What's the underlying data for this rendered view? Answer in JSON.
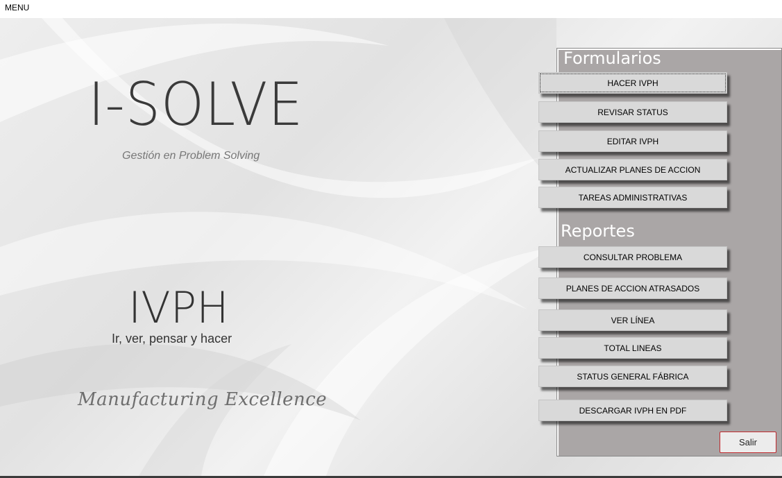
{
  "window": {
    "title": "MENU"
  },
  "branding": {
    "name": "I-SOLVE",
    "tagline": "Gestión en Problem Solving",
    "program": "IVPH",
    "program_tagline": "Ir, ver, pensar y hacer",
    "slogan": "Manufacturing Excellence"
  },
  "formularios": {
    "title": "Formularios",
    "buttons": [
      "HACER IVPH",
      "REVISAR STATUS",
      "EDITAR IVPH",
      "ACTUALIZAR PLANES DE ACCION",
      "TAREAS ADMINISTRATIVAS"
    ]
  },
  "reportes": {
    "title": "Reportes",
    "buttons": [
      "CONSULTAR PROBLEMA",
      "PLANES DE ACCION ATRASADOS",
      "VER LÍNEA",
      "TOTAL LINEAS",
      "STATUS GENERAL FÁBRICA",
      "DESCARGAR IVPH EN PDF"
    ]
  },
  "exit_label": "Salir",
  "colors": {
    "panel": "#aaa6a6",
    "button": "#d9d9d9",
    "exit_border": "#c0282d"
  }
}
